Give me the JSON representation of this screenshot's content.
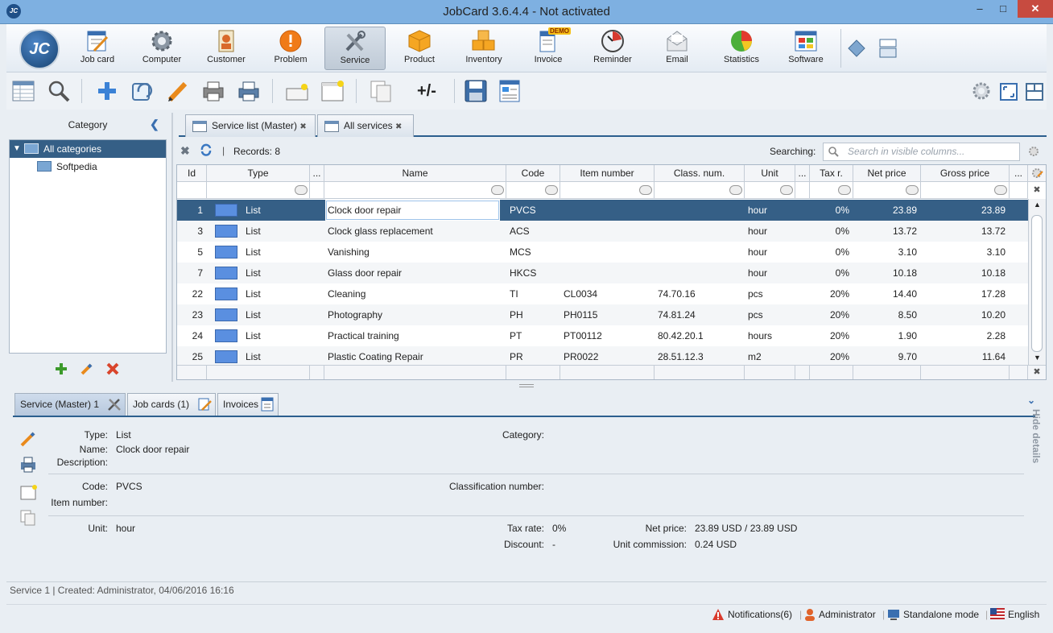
{
  "window": {
    "title": "JobCard 3.6.4.4 - Not activated",
    "icon_text": "JC",
    "minimize": "–",
    "maximize": "□",
    "close": "✕"
  },
  "logo": {
    "text": "JC"
  },
  "modules": [
    {
      "label": "Job card",
      "icon": "job-card-icon"
    },
    {
      "label": "Computer",
      "icon": "gear-icon"
    },
    {
      "label": "Customer",
      "icon": "customer-icon"
    },
    {
      "label": "Problem",
      "icon": "warning-icon"
    },
    {
      "label": "Service",
      "icon": "tools-icon",
      "active": true
    },
    {
      "label": "Product",
      "icon": "box-icon"
    },
    {
      "label": "Inventory",
      "icon": "boxes-icon"
    },
    {
      "label": "Invoice",
      "icon": "invoice-icon",
      "badge": "DEMO"
    },
    {
      "label": "Reminder",
      "icon": "clock-icon"
    },
    {
      "label": "Email",
      "icon": "envelope-icon"
    },
    {
      "label": "Statistics",
      "icon": "pie-chart-icon"
    },
    {
      "label": "Software",
      "icon": "window-icon"
    }
  ],
  "toolbar2": {
    "plusminus": "+/-"
  },
  "category": {
    "header": "Category",
    "collapse": "❮",
    "items": [
      {
        "label": "All categories"
      },
      {
        "label": "Softpedia"
      }
    ]
  },
  "tabs": [
    {
      "label": "Service list (Master)"
    },
    {
      "label": "All services"
    }
  ],
  "grid": {
    "records": "Records: 8",
    "searching_label": "Searching:",
    "search_placeholder": "Search in visible columns...",
    "columns": [
      "Id",
      "Type",
      "...",
      "Name",
      "Code",
      "Item number",
      "Class. num.",
      "Unit",
      "...",
      "Tax r.",
      "Net price",
      "Gross price",
      "..."
    ],
    "rows": [
      {
        "id": "1",
        "type": "List",
        "name": "Clock door repair",
        "code": "PVCS",
        "item": "",
        "class": "",
        "unit": "hour",
        "tax": "0%",
        "net": "23.89",
        "gross": "23.89"
      },
      {
        "id": "3",
        "type": "List",
        "name": "Clock glass replacement",
        "code": "ACS",
        "item": "",
        "class": "",
        "unit": "hour",
        "tax": "0%",
        "net": "13.72",
        "gross": "13.72"
      },
      {
        "id": "5",
        "type": "List",
        "name": "Vanishing",
        "code": "MCS",
        "item": "",
        "class": "",
        "unit": "hour",
        "tax": "0%",
        "net": "3.10",
        "gross": "3.10"
      },
      {
        "id": "7",
        "type": "List",
        "name": "Glass door repair",
        "code": "HKCS",
        "item": "",
        "class": "",
        "unit": "hour",
        "tax": "0%",
        "net": "10.18",
        "gross": "10.18"
      },
      {
        "id": "22",
        "type": "List",
        "name": "Cleaning",
        "code": "TI",
        "item": "CL0034",
        "class": "74.70.16",
        "unit": "pcs",
        "tax": "20%",
        "net": "14.40",
        "gross": "17.28"
      },
      {
        "id": "23",
        "type": "List",
        "name": "Photography",
        "code": "PH",
        "item": "PH0115",
        "class": "74.81.24",
        "unit": "pcs",
        "tax": "20%",
        "net": "8.50",
        "gross": "10.20"
      },
      {
        "id": "24",
        "type": "List",
        "name": "Practical training",
        "code": "PT",
        "item": "PT00112",
        "class": "80.42.20.1",
        "unit": "hours",
        "tax": "20%",
        "net": "1.90",
        "gross": "2.28"
      },
      {
        "id": "25",
        "type": "List",
        "name": "Plastic Coating Repair",
        "code": "PR",
        "item": "PR0022",
        "class": "28.51.12.3",
        "unit": "m2",
        "tax": "20%",
        "net": "9.70",
        "gross": "11.64"
      }
    ]
  },
  "detail_tabs": [
    {
      "label": "Service (Master) 1"
    },
    {
      "label": "Job cards (1)"
    },
    {
      "label": "Invoices"
    }
  ],
  "detail": {
    "type_label": "Type:",
    "type": "List",
    "name_label": "Name:",
    "name": "Clock door repair",
    "description_label": "Description:",
    "category_label": "Category:",
    "code_label": "Code:",
    "code": "PVCS",
    "item_number_label": "Item number:",
    "classification_label": "Classification number:",
    "unit_label": "Unit:",
    "unit": "hour",
    "tax_rate_label": "Tax rate:",
    "tax_rate": "0%",
    "discount_label": "Discount:",
    "discount": "-",
    "net_price_label": "Net price:",
    "net_price": "23.89 USD / 23.89 USD",
    "unit_commission_label": "Unit commission:",
    "unit_commission": "0.24 USD",
    "hide_details": "Hide details"
  },
  "status": {
    "created": "Service 1 | Created: Administrator, 04/06/2016 16:16",
    "notifications": "Notifications(6)",
    "user": "Administrator",
    "mode": "Standalone mode",
    "language": "English"
  }
}
